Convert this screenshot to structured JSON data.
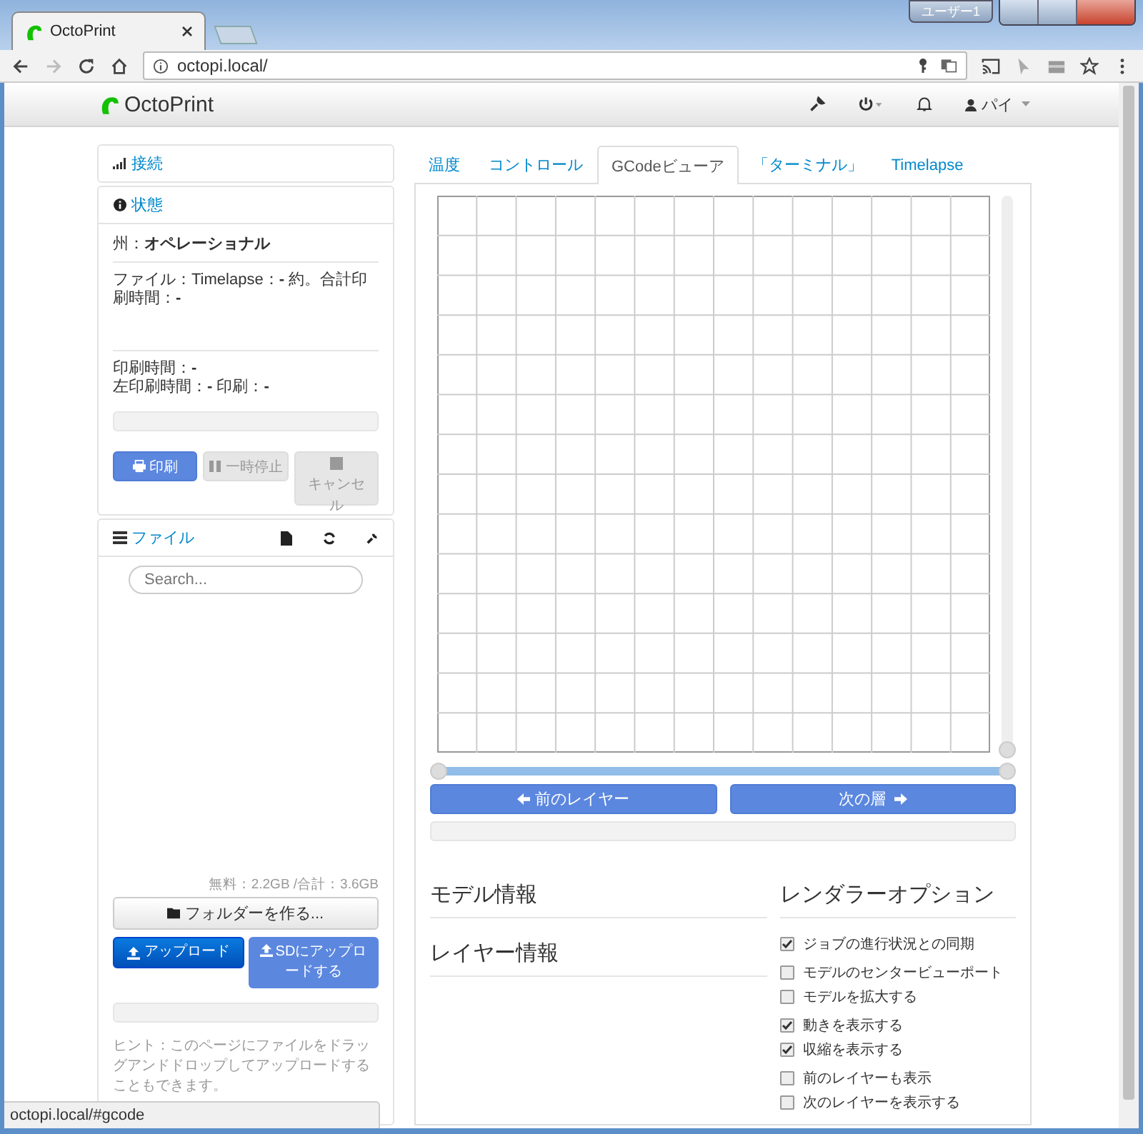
{
  "browser": {
    "profile_button": "ユーザー1",
    "tab_title": "OctoPrint",
    "url": "octopi.local/"
  },
  "navbar": {
    "brand": "OctoPrint",
    "user": "パイ"
  },
  "connection": {
    "title": "接続"
  },
  "state": {
    "title": "状態",
    "state_line": "州：**オペレーショナル**",
    "file_line": "ファイル：Timelapse：**-** 約。合計印刷時間：**-**",
    "print_time": "印刷時間：**-**",
    "print_time_left": "左印刷時間：**-** 印刷：**-**",
    "progress": {
      "level": 0
    },
    "buttons": [
      {
        "label": "印刷",
        "kind": "print",
        "disabled": false
      },
      {
        "label": "一時停止",
        "kind": "pause",
        "disabled": true
      },
      {
        "label": "キャンセル",
        "kind": "cancel",
        "disabled": true
      }
    ]
  },
  "files": {
    "title": "ファイル",
    "search_placeholder": "Search...",
    "usage": "無料：2.2GB /合計：3.6GB",
    "new_folder": "フォルダーを作る...",
    "upload_buttons": [
      {
        "label": "アップロード",
        "disabled": false
      },
      {
        "label": "SDにアップロードする",
        "disabled": true
      }
    ],
    "upload_progress": {
      "level": 0
    },
    "hint": "ヒント：このページにファイルをドラッグアンドドロップしてアップロードすることもできます。"
  },
  "tabs": [
    {
      "label": "温度",
      "selected": false
    },
    {
      "label": "コントロール",
      "selected": false
    },
    {
      "label": "GCodeビューア",
      "selected": true
    },
    {
      "label": "「ターミナル」",
      "selected": false
    },
    {
      "label": "Timelapse",
      "selected": false
    }
  ],
  "viewer": {
    "layer_slider": {
      "level": 0
    },
    "position_slider": {
      "level": 1
    },
    "prev_button": "前のレイヤー",
    "next_button": "次の層",
    "layer_progress": {
      "level": 0
    },
    "model_info": "モデル情報",
    "layer_info": "レイヤー情報",
    "renderer_title": "レンダラーオプション",
    "options": [
      {
        "label": "ジョブの進行状況との同期",
        "checked": true
      },
      {
        "label": "モデルのセンタービューポート",
        "checked": false
      },
      {
        "label": "モデルを拡大する",
        "checked": false
      },
      {
        "label": "動きを表示する",
        "checked": true
      },
      {
        "label": "収縮を表示する",
        "checked": true
      },
      {
        "label": "前のレイヤーも表示",
        "checked": false
      },
      {
        "label": "次のレイヤーを表示する",
        "checked": false
      }
    ]
  },
  "status_bar": "octopi.local/#gcode"
}
